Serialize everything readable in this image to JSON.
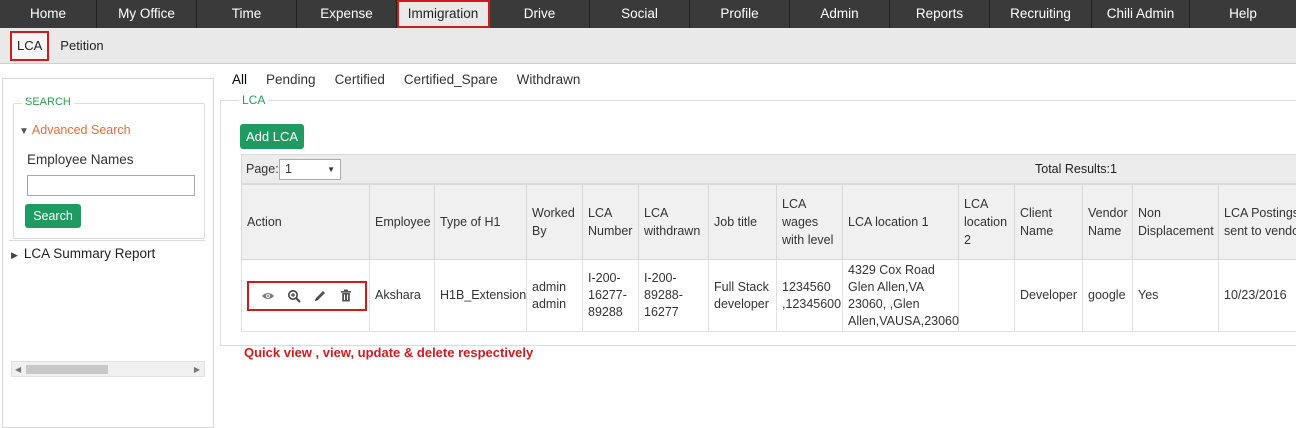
{
  "topnav": {
    "items": [
      {
        "label": "Home",
        "active": false
      },
      {
        "label": "My Office",
        "active": false
      },
      {
        "label": "Time",
        "active": false
      },
      {
        "label": "Expense",
        "active": false
      },
      {
        "label": "Immigration",
        "active": true
      },
      {
        "label": "Drive",
        "active": false
      },
      {
        "label": "Social",
        "active": false
      },
      {
        "label": "Profile",
        "active": false
      },
      {
        "label": "Admin",
        "active": false
      },
      {
        "label": "Reports",
        "active": false
      },
      {
        "label": "Recruiting",
        "active": false
      },
      {
        "label": "Chili Admin",
        "active": false
      },
      {
        "label": "Help",
        "active": false
      }
    ]
  },
  "subnav": {
    "items": [
      {
        "label": "LCA",
        "active": true
      },
      {
        "label": "Petition",
        "active": false
      }
    ]
  },
  "sidebar": {
    "search_legend": "SEARCH",
    "advanced_search": "Advanced Search",
    "employee_names_label": "Employee Names",
    "employee_names_value": "",
    "search_button": "Search",
    "lca_summary_report": "LCA Summary Report"
  },
  "status_tabs": [
    {
      "label": "All",
      "active": true
    },
    {
      "label": "Pending",
      "active": false
    },
    {
      "label": "Certified",
      "active": false
    },
    {
      "label": "Certified_Spare",
      "active": false
    },
    {
      "label": "Withdrawn",
      "active": false
    }
  ],
  "lca": {
    "legend": "LCA",
    "add_button": "Add LCA",
    "page_label": "Page:",
    "page_value": "1",
    "total_results": "Total Results:1"
  },
  "table": {
    "headers": [
      "Action",
      "Employee",
      "Type of H1",
      "Worked By",
      "LCA Number",
      "LCA withdrawn",
      "Job title",
      "LCA wages with level",
      "LCA location 1",
      "LCA location 2",
      "Client Name",
      "Vendor Name",
      "Non Displacement",
      "LCA Postings sent to vendor"
    ],
    "rows": [
      [
        "",
        "Akshara",
        "H1B_Extension",
        "admin admin",
        "I-200-16277-89288",
        "I-200-89288-16277",
        "Full Stack developer",
        "1234560 ,12345600",
        "4329 Cox Road Glen Allen,VA 23060, ,Glen Allen,VAUSA,23060",
        "",
        "Developer",
        "google",
        "Yes",
        "10/23/2016"
      ]
    ],
    "action_icons": [
      "eye-icon",
      "zoom-icon",
      "pencil-icon",
      "trash-icon"
    ]
  },
  "annotation_note": "Quick view , view, update & delete respectively",
  "colors": {
    "nav_bg": "#3a3a3a",
    "accent_green": "#1f9b62",
    "highlight_red": "#d11b1b",
    "link_orange": "#e07040"
  }
}
